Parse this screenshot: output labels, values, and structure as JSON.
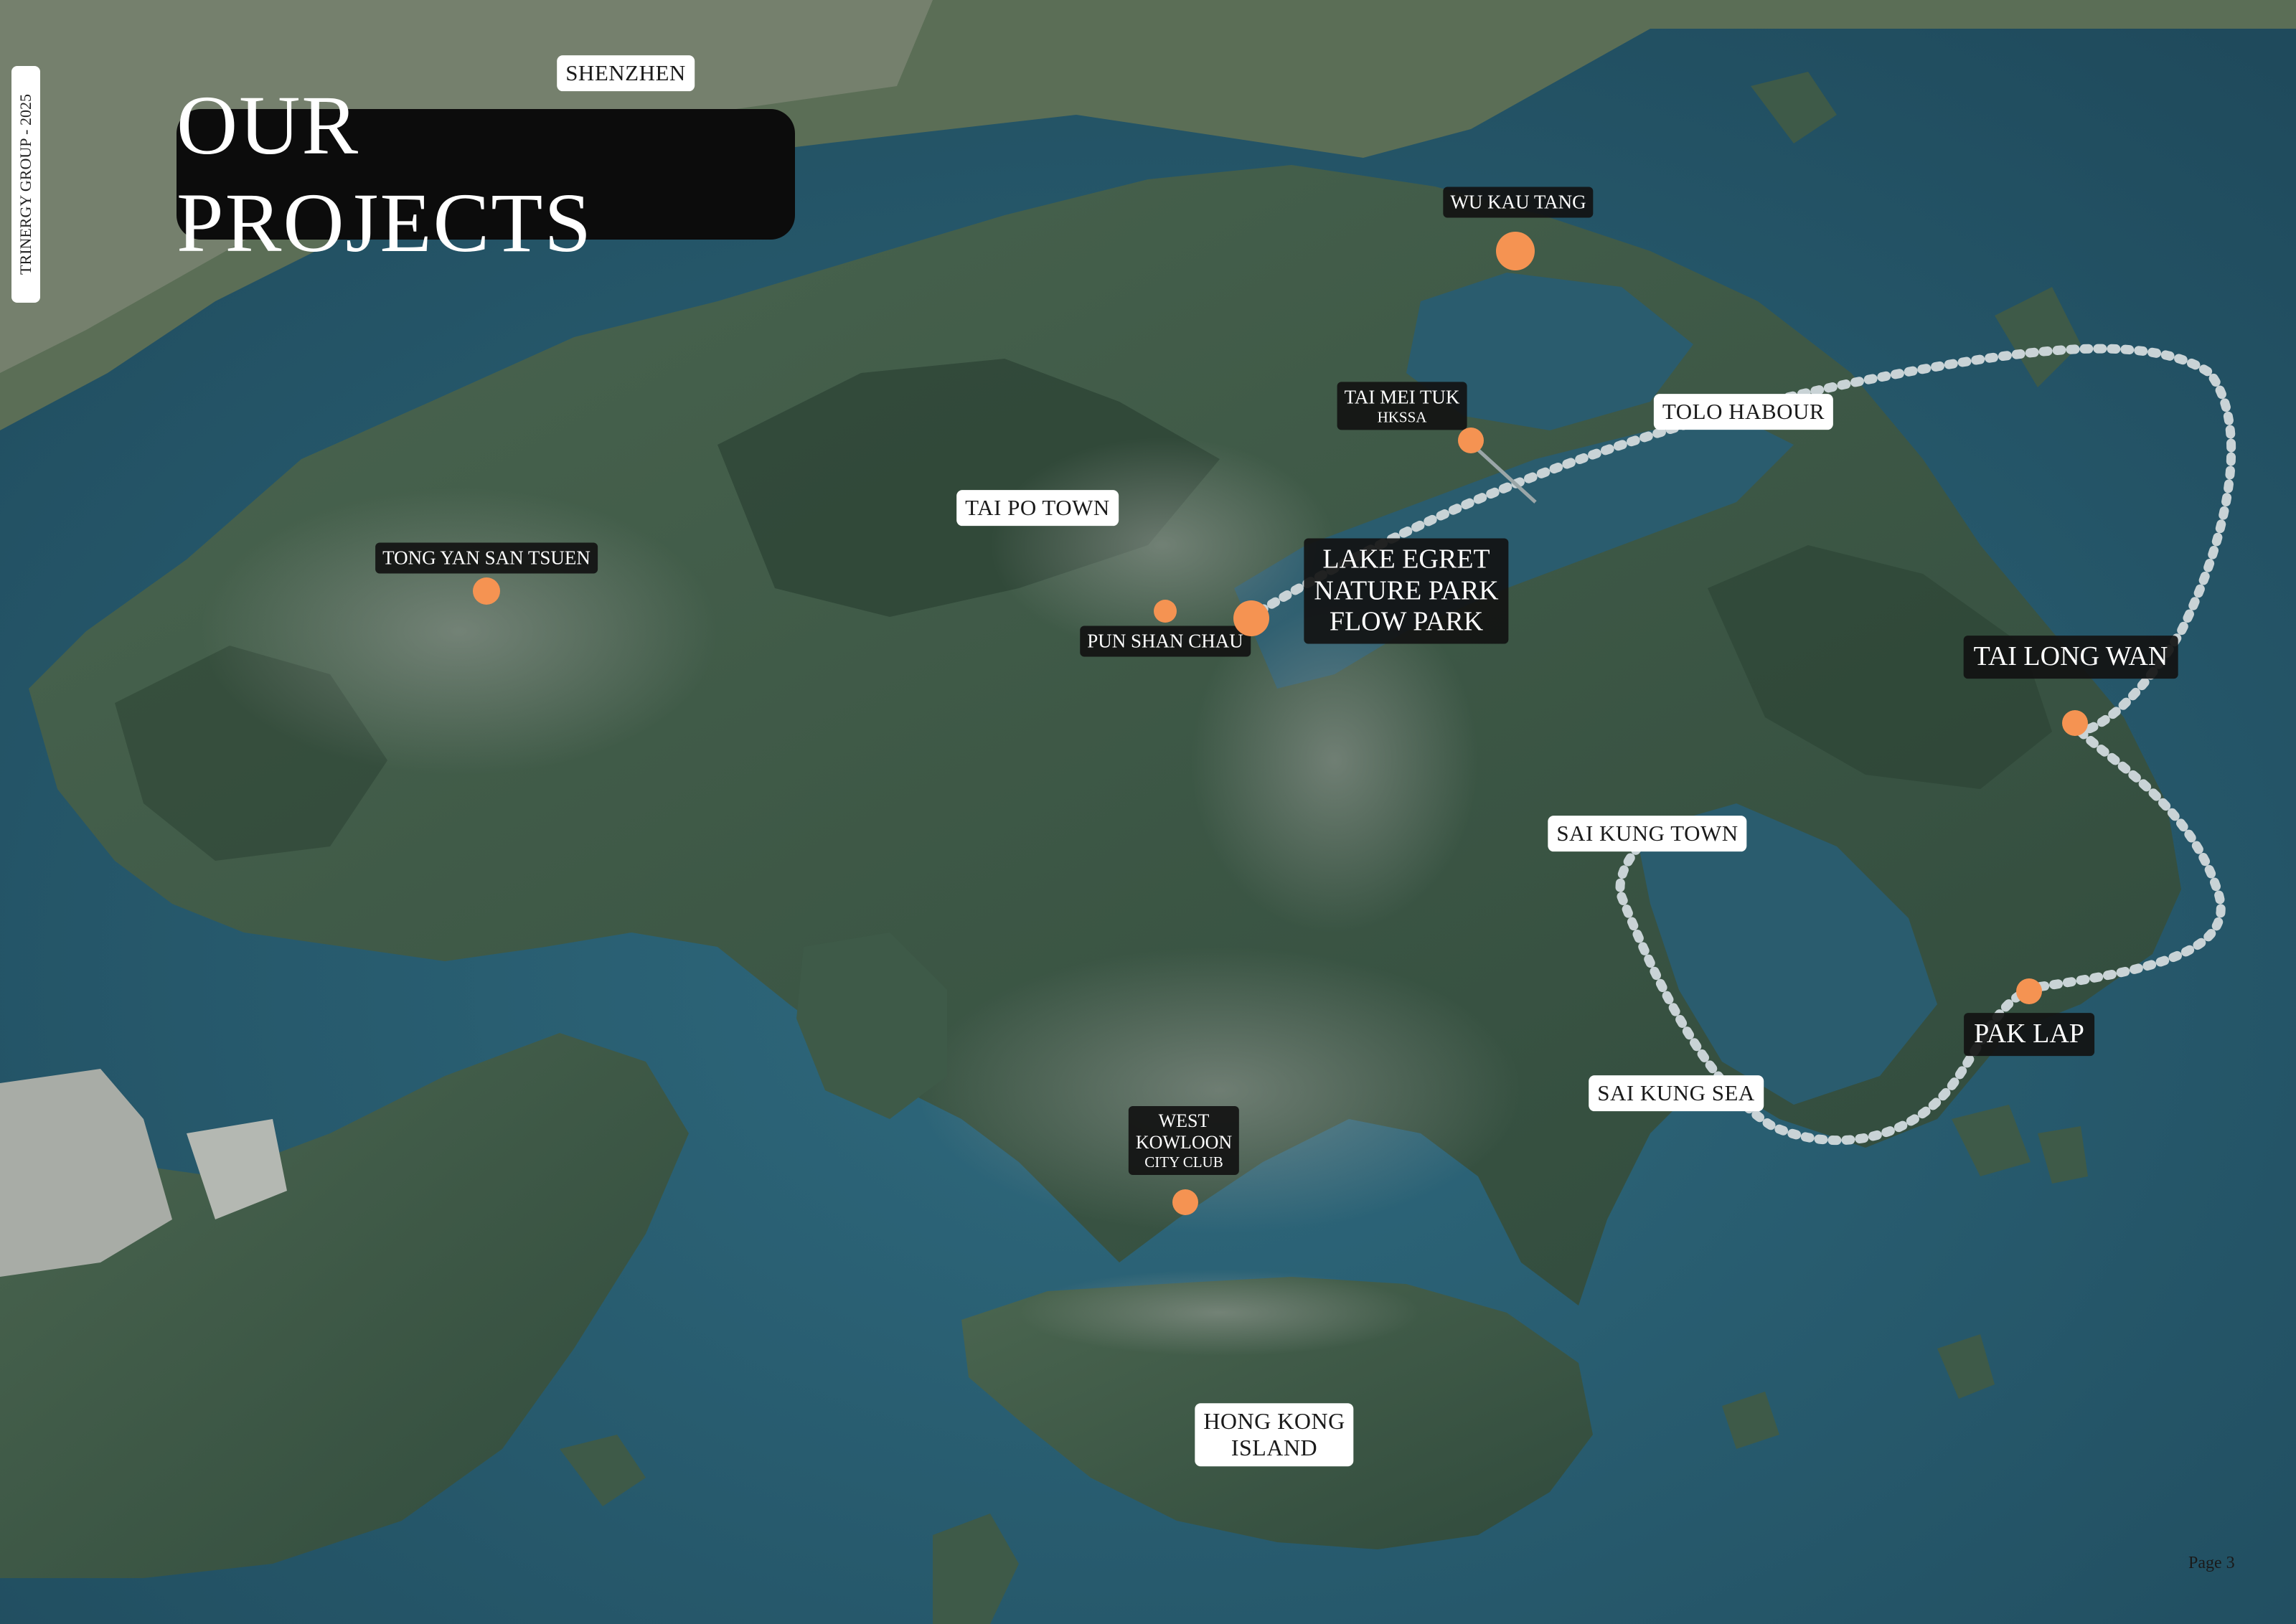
{
  "page": {
    "title": "OUR PROJECTS",
    "side_credit": "TRINERGY GROUP - 2025",
    "page_number": "Page 3"
  },
  "colors": {
    "sea": "#2c5f72",
    "land": "#3e5a48",
    "marker": "#f59352",
    "route": "#c9d3d6",
    "label_dark_bg": "#121212",
    "label_light_bg": "#ffffff"
  },
  "places": {
    "shenzhen": "SHENZHEN",
    "tai_po_town": "TAI PO TOWN",
    "tolo_habour": "TOLO HABOUR",
    "sai_kung_town": "SAI KUNG TOWN",
    "sai_kung_sea": "SAI KUNG SEA",
    "hong_kong_island": [
      "HONG KONG",
      "ISLAND"
    ]
  },
  "projects": {
    "wu_kau_tang": "WU KAU TANG",
    "tai_mei_tuk": {
      "name": "TAI MEI TUK",
      "sub": "HKSSA"
    },
    "tong_yan_san_tsuen": "TONG YAN SAN TSUEN",
    "pun_shan_chau": "PUN SHAN CHAU",
    "lake_egret": [
      "LAKE EGRET",
      "NATURE PARK",
      "FLOW PARK"
    ],
    "tai_long_wan": "TAI LONG WAN",
    "pak_lap": "PAK LAP",
    "west_kowloon": {
      "lines": [
        "WEST",
        "KOWLOON"
      ],
      "sub": "CITY CLUB"
    }
  }
}
